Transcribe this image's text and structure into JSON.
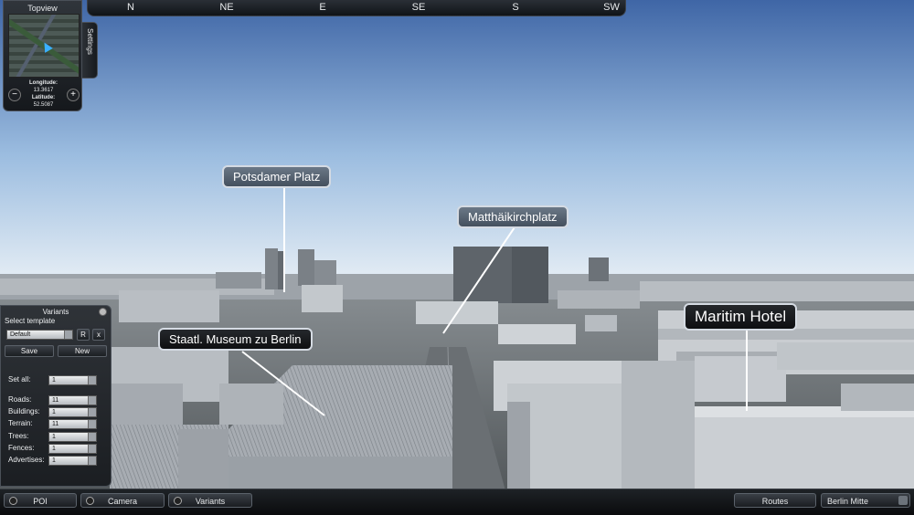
{
  "compass": {
    "labels": [
      "N",
      "NE",
      "E",
      "SE",
      "S",
      "SW"
    ]
  },
  "topview": {
    "title": "Topview",
    "longitude_label": "Longitude:",
    "longitude_value": "13.3617",
    "latitude_label": "Latitude:",
    "latitude_value": "52.5087",
    "zoom_out": "−",
    "zoom_in": "+"
  },
  "settings_tab": "Settings",
  "callouts": {
    "potsdamer": "Potsdamer Platz",
    "matthai": "Matthäikirchplatz",
    "museum": "Staatl. Museum zu Berlin",
    "maritim": "Maritim Hotel"
  },
  "variants": {
    "title": "Variants",
    "select_template_label": "Select template",
    "template_value": "Default",
    "r_button": "R",
    "x_button": "x",
    "save_button": "Save",
    "new_button": "New",
    "set_all_label": "Set all:",
    "set_all_value": "1",
    "rows": [
      {
        "label": "Roads:",
        "value": "11"
      },
      {
        "label": "Buildings:",
        "value": "1"
      },
      {
        "label": "Terrain:",
        "value": "11"
      },
      {
        "label": "Trees:",
        "value": "1"
      },
      {
        "label": "Fences:",
        "value": "1"
      },
      {
        "label": "Advertises:",
        "value": "1"
      }
    ]
  },
  "bottombar": {
    "poi": "POI",
    "camera": "Camera",
    "variants": "Variants",
    "routes": "Routes",
    "district": "Berlin Mitte"
  }
}
